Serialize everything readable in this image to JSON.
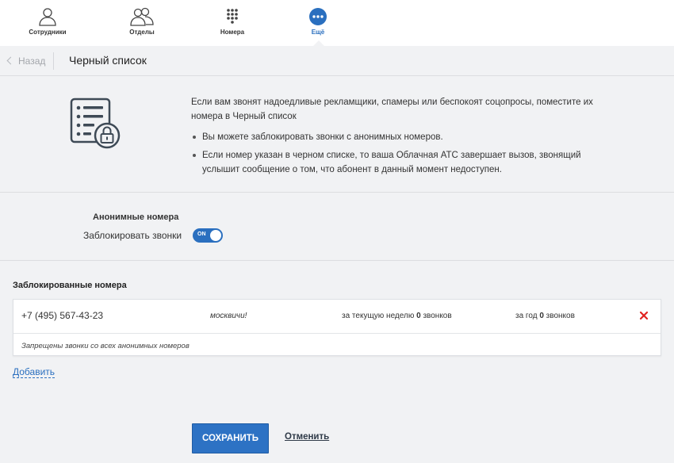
{
  "nav": {
    "items": [
      {
        "label": "Сотрудники",
        "icon": "user-icon",
        "active": false
      },
      {
        "label": "Отделы",
        "icon": "users-group-icon",
        "active": false
      },
      {
        "label": "Номера",
        "icon": "dialpad-icon",
        "active": false
      },
      {
        "label": "Ещё",
        "icon": "more-dots-icon",
        "active": true
      }
    ]
  },
  "header": {
    "back_label": "Назад",
    "title": "Черный список"
  },
  "info": {
    "icon": "blacklist-lock-icon",
    "intro": "Если вам звонят надоедливые рекламщики, спамеры или беспокоят соцопросы, поместите их номера в Черный список",
    "bullets": [
      "Вы можете заблокировать звонки с анонимных номеров.",
      "Если номер указан в черном списке, то ваша Облачная АТС завершает вызов, звонящий услышит сообщение о том, что абонент в данный момент недоступен."
    ]
  },
  "anonymous": {
    "title": "Анонимные номера",
    "block_label": "Заблокировать звонки",
    "toggle_text": "ON",
    "enabled": true
  },
  "blocked": {
    "title": "Заблокированные номера",
    "rows": [
      {
        "phone": "+7 (495) 567-43-23",
        "note": "москвичи!",
        "week_prefix": "за текущую неделю",
        "week_count": "0",
        "week_suffix": "звонков",
        "year_prefix": "за год",
        "year_count": "0",
        "year_suffix": "звонков"
      }
    ],
    "footer": "Запрещены звонки со всех анонимных номеров",
    "add_label": "Добавить"
  },
  "actions": {
    "save_label": "СОХРАНИТЬ",
    "cancel_label": "Отменить"
  },
  "colors": {
    "accent": "#2a6fbf",
    "delete": "#e0231f",
    "background": "#f1f2f4"
  }
}
